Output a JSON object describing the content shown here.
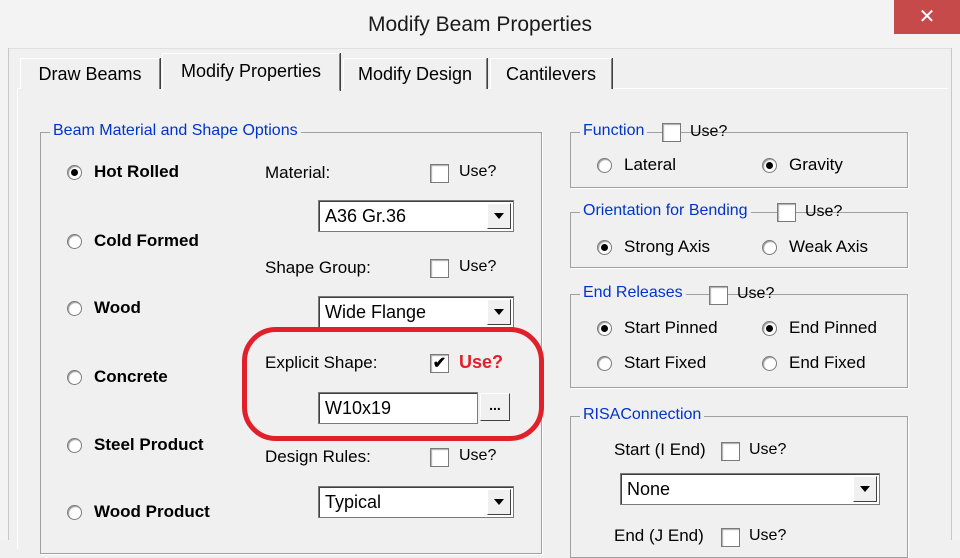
{
  "window": {
    "title": "Modify Beam Properties",
    "close_glyph": "✕"
  },
  "tabs": [
    {
      "label": "Draw Beams"
    },
    {
      "label": "Modify Properties"
    },
    {
      "label": "Modify Design"
    },
    {
      "label": "Cantilevers"
    }
  ],
  "material_group": {
    "legend": "Beam Material and Shape Options",
    "radios": [
      {
        "label": "Hot Rolled",
        "selected": true
      },
      {
        "label": "Cold Formed",
        "selected": false
      },
      {
        "label": "Wood",
        "selected": false
      },
      {
        "label": "Concrete",
        "selected": false
      },
      {
        "label": "Steel Product",
        "selected": false
      },
      {
        "label": "Wood Product",
        "selected": false
      }
    ],
    "material": {
      "label": "Material:",
      "use_label": "Use?",
      "use_checked": false,
      "value": "A36 Gr.36"
    },
    "shape_group": {
      "label": "Shape Group:",
      "use_label": "Use?",
      "use_checked": false,
      "value": "Wide Flange"
    },
    "explicit_shape": {
      "label": "Explicit Shape:",
      "use_label": "Use?",
      "use_checked": true,
      "value": "W10x19",
      "browse_label": "...",
      "highlight_color": "#e0202a"
    },
    "design_rules": {
      "label": "Design Rules:",
      "use_label": "Use?",
      "use_checked": false,
      "value": "Typical"
    }
  },
  "function_group": {
    "legend": "Function",
    "use_label": "Use?",
    "use_checked": false,
    "options": [
      {
        "label": "Lateral",
        "selected": false
      },
      {
        "label": "Gravity",
        "selected": true
      }
    ]
  },
  "orientation_group": {
    "legend": "Orientation for Bending",
    "use_label": "Use?",
    "use_checked": false,
    "options": [
      {
        "label": "Strong Axis",
        "selected": true
      },
      {
        "label": "Weak Axis",
        "selected": false
      }
    ]
  },
  "end_releases_group": {
    "legend": "End Releases",
    "use_label": "Use?",
    "use_checked": false,
    "options": [
      {
        "label": "Start Pinned",
        "selected": true
      },
      {
        "label": "End Pinned",
        "selected": true
      },
      {
        "label": "Start Fixed",
        "selected": false
      },
      {
        "label": "End Fixed",
        "selected": false
      }
    ]
  },
  "risa_group": {
    "legend": "RISAConnection",
    "start": {
      "label": "Start (I End)",
      "use_label": "Use?",
      "use_checked": false,
      "value": "None"
    },
    "end": {
      "label": "End (J End)",
      "use_label": "Use?",
      "use_checked": false
    }
  },
  "colors": {
    "legend_blue": "#0033cc",
    "use_red": "#e0202a",
    "close_red": "#c74a4a"
  }
}
